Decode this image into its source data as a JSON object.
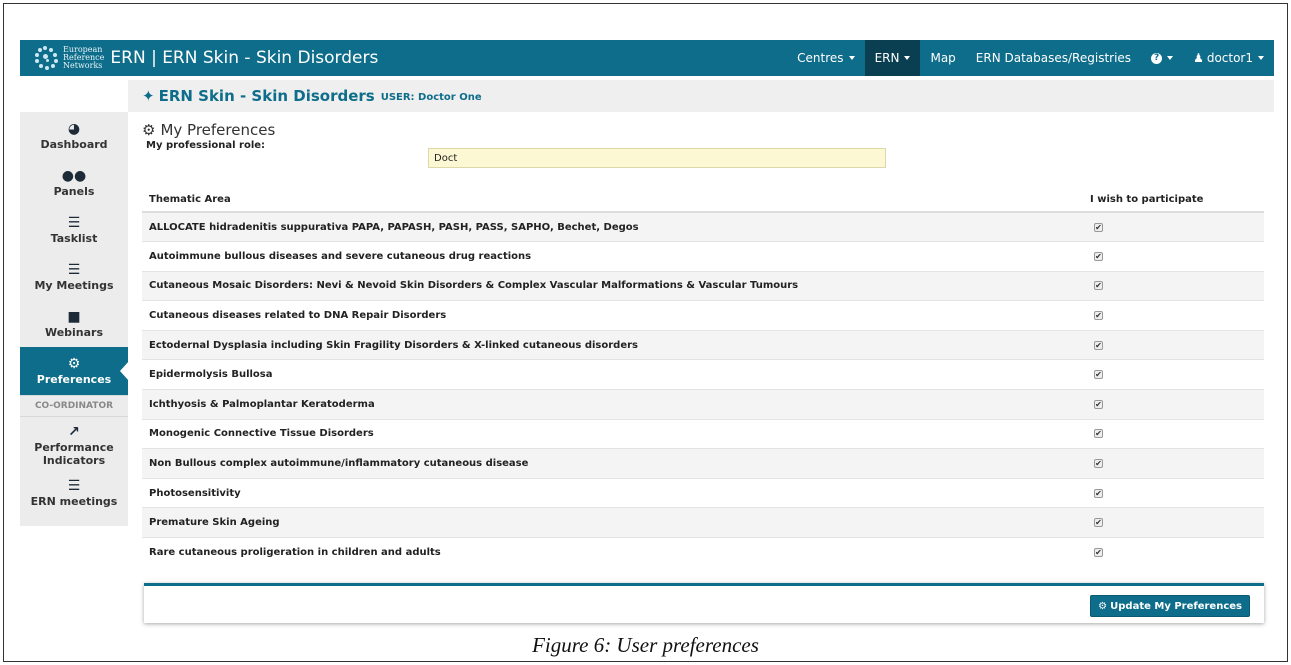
{
  "brand": {
    "logo_text_1": "European",
    "logo_text_2": "Reference",
    "logo_text_3": "Networks",
    "separator": "|",
    "app_title": "ERN | ERN Skin - Skin Disorders"
  },
  "nav": {
    "items": [
      {
        "label": "Centres",
        "dropdown": true
      },
      {
        "label": "ERN",
        "dropdown": true,
        "active": true
      },
      {
        "label": "Map",
        "dropdown": false
      },
      {
        "label": "ERN Databases/Registries",
        "dropdown": false
      },
      {
        "label": "?",
        "dropdown": true
      },
      {
        "label": "doctor1",
        "dropdown": true
      }
    ]
  },
  "subheader": {
    "title": "ERN Skin - Skin Disorders",
    "user_label": "USER: Doctor One"
  },
  "sidebar": {
    "items": [
      {
        "label": "Dashboard",
        "icon": "dashboard-icon"
      },
      {
        "label": "Panels",
        "icon": "users-icon"
      },
      {
        "label": "Tasklist",
        "icon": "tasklist-icon"
      },
      {
        "label": "My Meetings",
        "icon": "meetings-icon"
      },
      {
        "label": "Webinars",
        "icon": "video-icon"
      },
      {
        "label": "Preferences",
        "icon": "gear-icon",
        "active": true
      }
    ],
    "section": "CO-ORDINATOR",
    "coordinator_items": [
      {
        "label": "Performance Indicators",
        "icon": "line-chart-icon"
      },
      {
        "label": "ERN meetings",
        "icon": "meetings-icon"
      }
    ]
  },
  "preferences": {
    "title": "My Preferences",
    "role_label": "My professional role:",
    "role_value": "Doct",
    "col_area": "Thematic Area",
    "col_participate": "I wish to participate",
    "rows": [
      {
        "area": "ALLOCATE hidradenitis suppurativa PAPA, PAPASH, PASH, PASS, SAPHO, Bechet, Degos",
        "checked": true
      },
      {
        "area": "Autoimmune bullous diseases and severe cutaneous drug reactions",
        "checked": true
      },
      {
        "area": "Cutaneous Mosaic Disorders: Nevi & Nevoid Skin Disorders & Complex Vascular Malformations & Vascular Tumours",
        "checked": true
      },
      {
        "area": "Cutaneous diseases related to DNA Repair Disorders",
        "checked": true
      },
      {
        "area": "Ectodernal Dysplasia including Skin Fragility Disorders & X-linked cutaneous disorders",
        "checked": true
      },
      {
        "area": "Epidermolysis Bullosa",
        "checked": true
      },
      {
        "area": "Ichthyosis & Palmoplantar Keratoderma",
        "checked": true
      },
      {
        "area": "Monogenic Connective Tissue Disorders",
        "checked": true
      },
      {
        "area": "Non Bullous complex autoimmune/inflammatory cutaneous disease",
        "checked": true
      },
      {
        "area": "Photosensitivity",
        "checked": true
      },
      {
        "area": "Premature Skin Ageing",
        "checked": true
      },
      {
        "area": "Rare cutaneous proligeration in children and adults",
        "checked": true
      }
    ],
    "update_button": "Update My Preferences"
  },
  "caption": "Figure 6: User preferences",
  "colors": {
    "primary": "#0e6d8a",
    "nav_active": "#0a3f52",
    "role_field": "#fcf8d4"
  }
}
